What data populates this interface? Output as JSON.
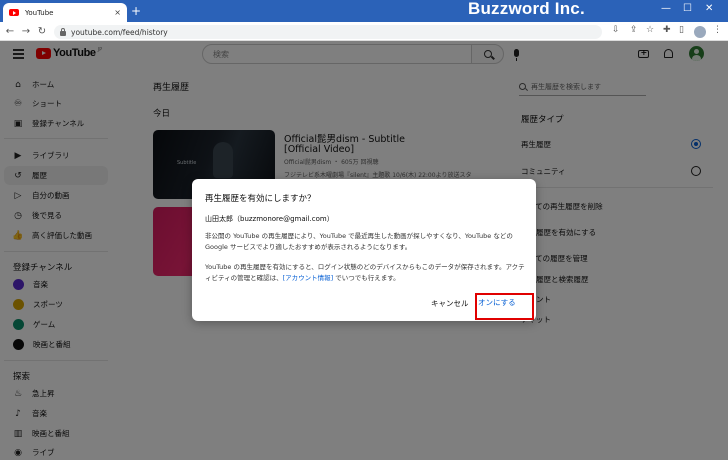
{
  "browser": {
    "tab_title": "YouTube",
    "tab_close": "×",
    "new_tab": "+",
    "url": "youtube.com/feed/history",
    "brand": "Buzzword Inc.",
    "win_min": "—",
    "win_max": "☐",
    "win_close": "✕",
    "nav": {
      "back": "←",
      "forward": "→",
      "reload": "↻"
    }
  },
  "header": {
    "logo_text": "YouTube",
    "logo_sup": "JP",
    "search_placeholder": "検索"
  },
  "sidebar": {
    "items": [
      {
        "label": "ホーム",
        "icon": "home-icon",
        "glyph": "⌂"
      },
      {
        "label": "ショート",
        "icon": "shorts-icon",
        "glyph": "♾"
      },
      {
        "label": "登録チャンネル",
        "icon": "subscriptions-icon",
        "glyph": "▣"
      },
      {
        "label": "ライブラリ",
        "icon": "library-icon",
        "glyph": "▶"
      },
      {
        "label": "履歴",
        "icon": "history-icon",
        "glyph": "↺"
      },
      {
        "label": "自分の動画",
        "icon": "your-videos-icon",
        "glyph": "▷"
      },
      {
        "label": "後で見る",
        "icon": "watch-later-icon",
        "glyph": "◷"
      },
      {
        "label": "高く評価した動画",
        "icon": "liked-videos-icon",
        "glyph": "👍"
      }
    ],
    "subscriptions_heading": "登録チャンネル",
    "channels": [
      {
        "label": "音楽",
        "color": "#5b2bd1"
      },
      {
        "label": "スポーツ",
        "color": "#d6a400"
      },
      {
        "label": "ゲーム",
        "color": "#0a8f6a"
      },
      {
        "label": "映画と番組",
        "color": "#111111"
      }
    ],
    "explore_heading": "探索",
    "explore": [
      {
        "label": "急上昇",
        "icon": "trending-icon",
        "glyph": "♨"
      },
      {
        "label": "音楽",
        "icon": "music-icon",
        "glyph": "♪"
      },
      {
        "label": "映画と番組",
        "icon": "movies-icon",
        "glyph": "▥"
      },
      {
        "label": "ライブ",
        "icon": "live-icon",
        "glyph": "◉"
      }
    ]
  },
  "main": {
    "title": "再生履歴",
    "section": "今日",
    "videos": [
      {
        "title1": "Official髭男dism - Subtitle",
        "title2": "[Official Video]",
        "meta": "Official髭男dism ・ 605万 回視聴",
        "desc": "フジテレビ系木曜劇場『silent』主題歌 10/6(木) 22:00より放送スタ",
        "thumb_text": "Subtitle"
      },
      {
        "title1": "",
        "title2": "",
        "meta": "",
        "desc": ""
      }
    ]
  },
  "right_panel": {
    "search_placeholder": "再生履歴を検索します",
    "heading": "履歴タイプ",
    "types": [
      {
        "label": "再生履歴",
        "selected": true
      },
      {
        "label": "コミュニティ",
        "selected": false
      }
    ],
    "actions": [
      "すべての再生履歴を削除",
      "再生履歴を有効にする",
      "すべての履歴を管理",
      "再生履歴と検索履歴",
      "コメント",
      "チャット"
    ]
  },
  "dialog": {
    "title": "再生履歴を有効にしますか？",
    "user": "山田太郎（buzzmonore@gmail.com）",
    "para1": "非公開の YouTube の再生履歴により、YouTube で最近再生した動画が探しやすくなり、YouTube などの Google サービスでより適したおすすめが表示されるようになります。",
    "para2_pre": "YouTube の再生履歴を有効にすると、ログイン状態のどのデバイスからもこのデータが保存されます。アクティビティの管理と確認は、",
    "para2_link": "[アカウント情報]",
    "para2_post": " でいつでも行えます。",
    "cancel": "キャンセル",
    "confirm": "オンにする"
  }
}
